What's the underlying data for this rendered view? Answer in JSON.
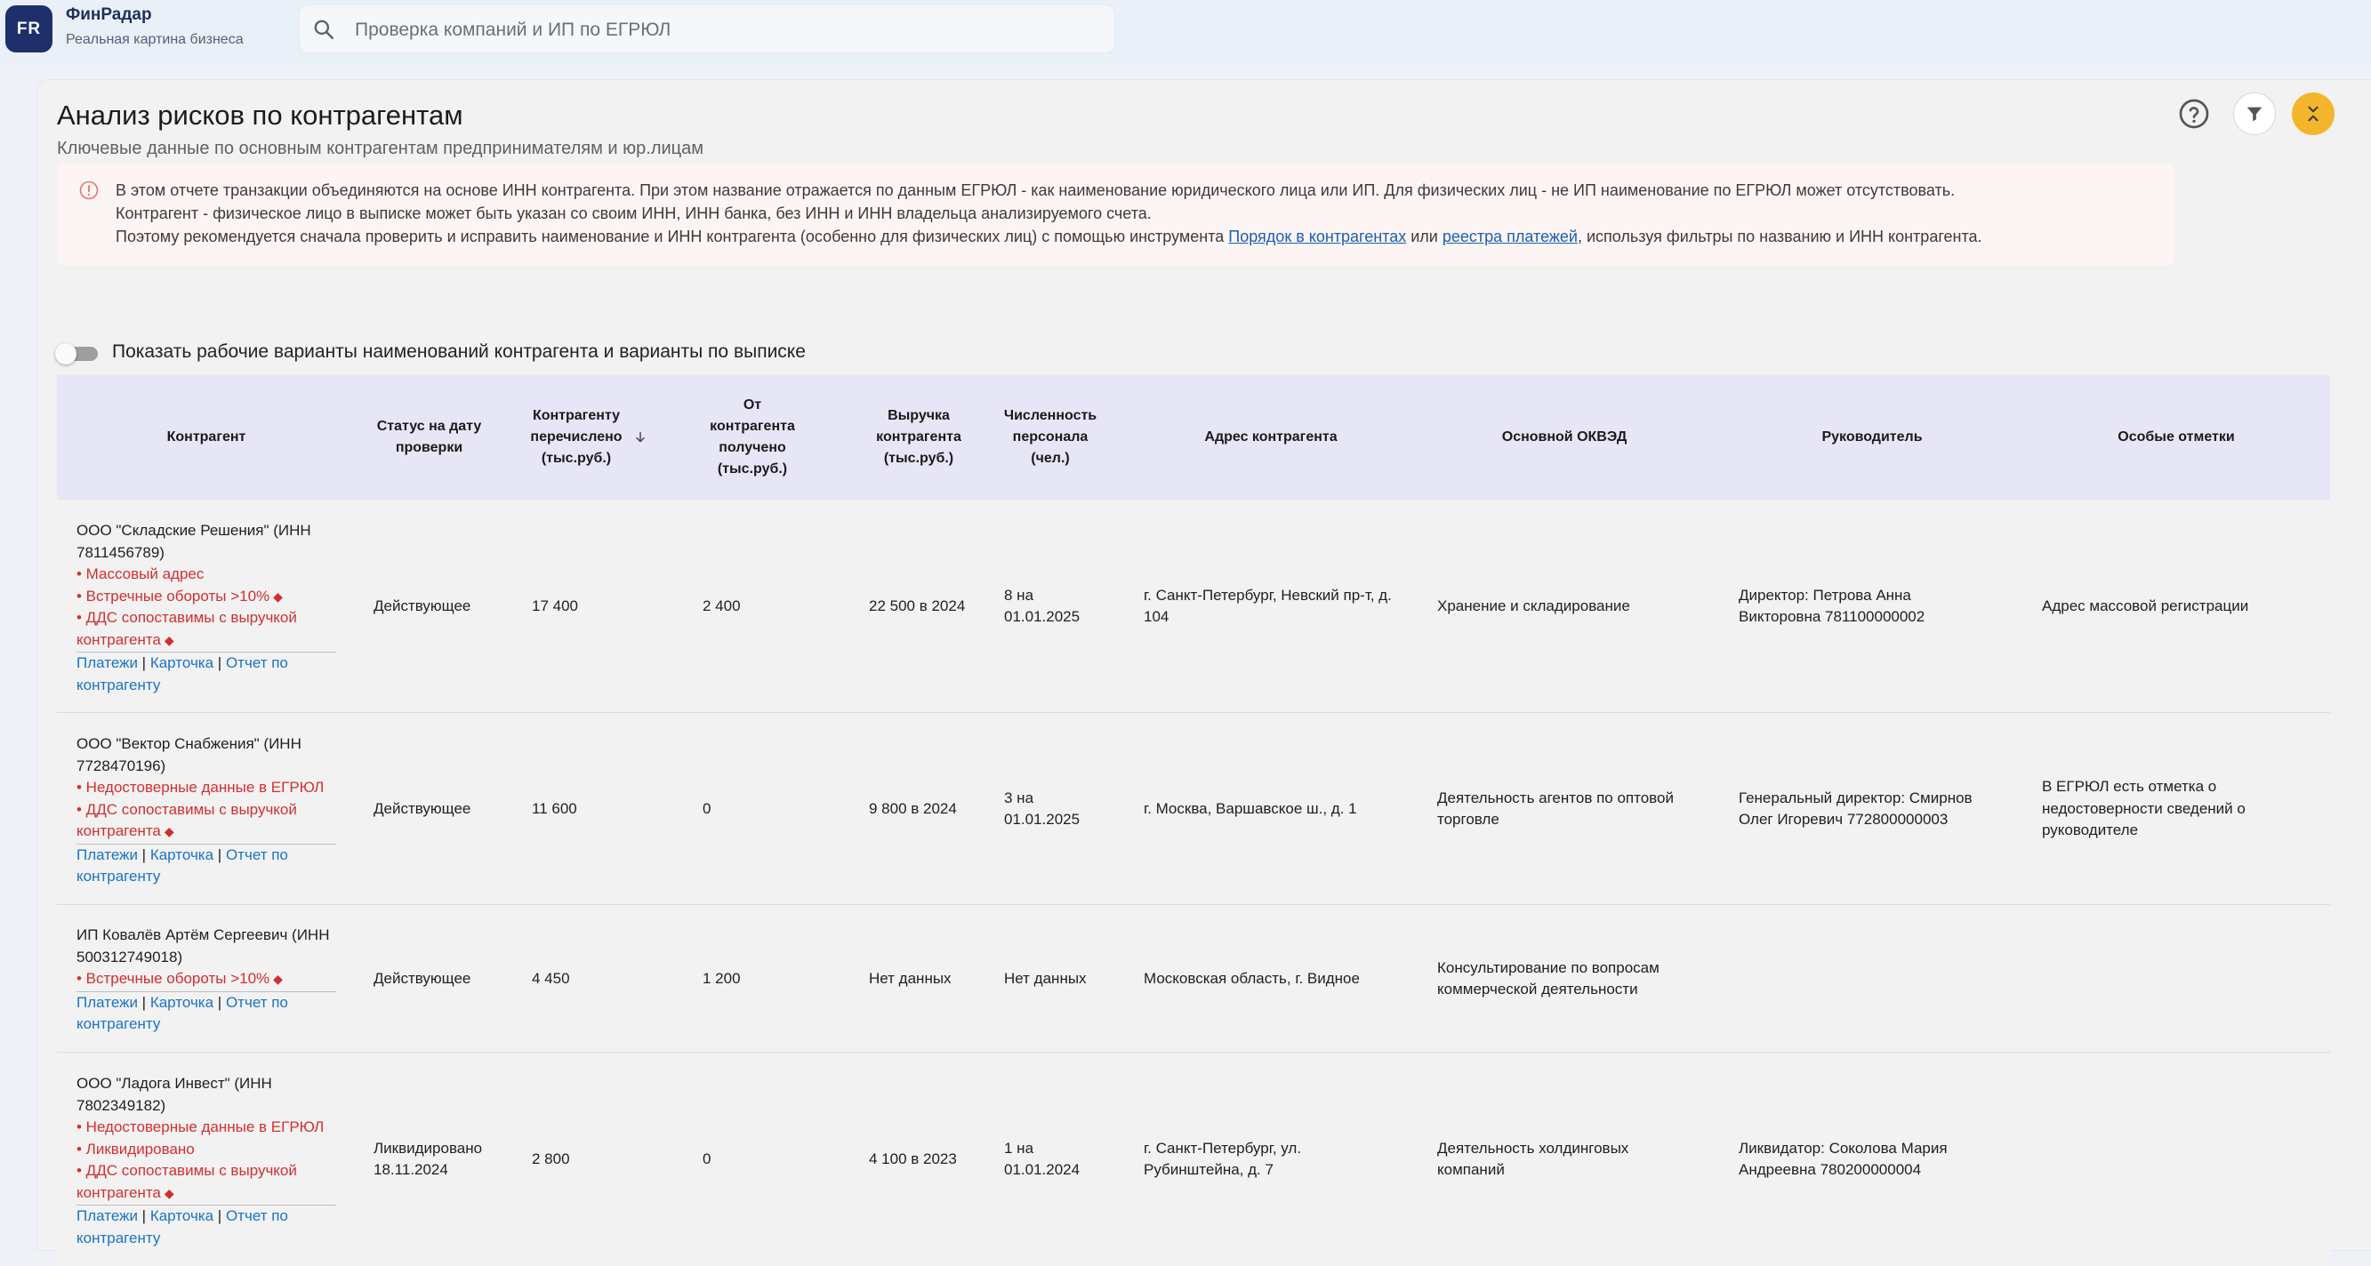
{
  "brand": {
    "logo_text": "FR",
    "name": "ФинРадар",
    "tagline": "Реальная картина бизнеса"
  },
  "search": {
    "placeholder": "Проверка компаний и ИП по ЕГРЮЛ",
    "value": ""
  },
  "page": {
    "title": "Анализ рисков по контрагентам",
    "subtitle": "Ключевые данные по основным контрагентам предпринимателям и юр.лицам"
  },
  "notice": {
    "line1": "В этом отчете транзакции объединяются на основе ИНН контрагента. При этом название отражается по данным ЕГРЮЛ - как наименование юридического лица или ИП. Для физических лиц - не ИП наименование по ЕГРЮЛ может отсутствовать.",
    "line2": "Контрагент - физическое лицо в выписке может быть указан со своим ИНН, ИНН банка, без ИНН и ИНН владельца анализируемого счета.",
    "line3_pre": "Поэтому рекомендуется сначала проверить и исправить наименование и ИНН контрагента (особенно для физических лиц) с помощью инструмента ",
    "link1": "Порядок в контрагентах",
    "line3_mid": " или ",
    "link2": "реестра платежей",
    "line3_post": ", используя фильтры по названию и ИНН контрагента."
  },
  "toggle": {
    "label": "Показать рабочие варианты наименований контрагента и варианты по выписке",
    "on": false
  },
  "table": {
    "headers": {
      "counterparty": "Контрагент",
      "status": "Статус на дату проверки",
      "paid": "Контрагенту перечислено (тыс.руб.)",
      "received": "От контрагента получено (тыс.руб.)",
      "revenue": "Выручка контрагента (тыс.руб.)",
      "staff": "Численность персонала (чел.)",
      "address": "Адрес контрагента",
      "okved": "Основной ОКВЭД",
      "head": "Руководитель",
      "notes": "Особые отметки"
    },
    "links": {
      "payments": "Платежи",
      "card": "Карточка",
      "report": "Отчет по контрагенту",
      "sep": " | "
    },
    "rows": [
      {
        "name": "ООО \"Складские Решения\" (ИНН 7811456789)",
        "flags": [
          "• Массовый адрес",
          "• Встречные обороты >10%",
          "• ДДС сопоставимы с выручкой контрагента"
        ],
        "status": "Действующее",
        "paid": "17 400",
        "received": "2 400",
        "revenue": "22 500 в 2024",
        "staff": "8 на 01.01.2025",
        "address": "г. Санкт-Петербург, Невский пр-т, д. 104",
        "okved": "Хранение и складирование",
        "head": "Директор: Петрова Анна Викторовна 781100000002",
        "notes": "Адрес массовой регистрации"
      },
      {
        "name": "ООО \"Вектор Снабжения\" (ИНН 7728470196)",
        "flags": [
          "• Недостоверные данные в ЕГРЮЛ",
          "• ДДС сопоставимы с выручкой контрагента"
        ],
        "status": "Действующее",
        "paid": "11 600",
        "received": "0",
        "revenue": "9 800 в 2024",
        "staff": "3 на 01.01.2025",
        "address": "г. Москва, Варшавское ш., д. 1",
        "okved": "Деятельность агентов по оптовой торговле",
        "head": "Генеральный директор: Смирнов Олег Игоревич 772800000003",
        "notes": "В ЕГРЮЛ есть отметка о недостоверности сведений о руководителе"
      },
      {
        "name": "ИП Ковалёв Артём Сергеевич (ИНН 500312749018)",
        "flags": [
          "• Встречные обороты >10%"
        ],
        "status": "Действующее",
        "paid": "4 450",
        "received": "1 200",
        "revenue": "Нет данных",
        "staff": "Нет данных",
        "address": "Московская область, г. Видное",
        "okved": "Консультирование по вопросам коммерческой деятельности",
        "head": "",
        "notes": ""
      },
      {
        "name": "ООО \"Ладога Инвест\" (ИНН 7802349182)",
        "flags": [
          "• Недостоверные данные в ЕГРЮЛ",
          "• Ликвидировано",
          "• ДДС сопоставимы с выручкой контрагента"
        ],
        "status": "Ликвидировано 18.11.2024",
        "paid": "2 800",
        "received": "0",
        "revenue": "4 100 в 2023",
        "staff": "1 на 01.01.2024",
        "address": "г. Санкт-Петербург, ул. Рубинштейна, д. 7",
        "okved": "Деятельность холдинговых компаний",
        "head": "Ликвидатор: Соколова Мария Андреевна 780200000004",
        "notes": ""
      }
    ]
  },
  "colors": {
    "accent": "#f3b62b",
    "header_bg": "#e6e6f7",
    "flag": "#d32f2f",
    "link": "#1a73c8",
    "logo": "#1f2f6b"
  }
}
